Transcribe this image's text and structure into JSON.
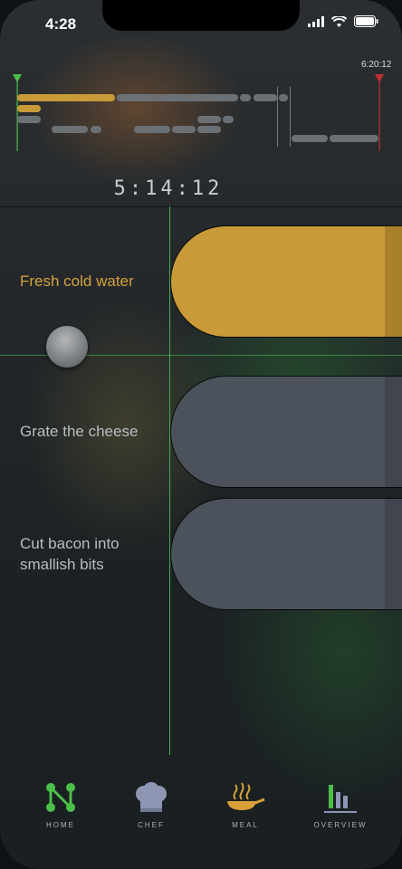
{
  "status": {
    "time": "4:28"
  },
  "timeline": {
    "end_time_label": "6:20:12"
  },
  "clock": "5:14:12",
  "tasks": [
    {
      "label": "Fresh cold water",
      "state": "active"
    },
    {
      "label": "Grate the cheese",
      "state": "pending"
    },
    {
      "label": "Cut bacon into smallish bits",
      "state": "pending"
    }
  ],
  "nav": [
    {
      "label": "HOME",
      "icon": "home-nodes-icon"
    },
    {
      "label": "CHEF",
      "icon": "chef-hat-icon"
    },
    {
      "label": "MEAL",
      "icon": "pan-icon"
    },
    {
      "label": "OVERVIEW",
      "icon": "bar-chart-icon"
    }
  ],
  "colors": {
    "accent_gold": "#c99a38",
    "pill_gray": "#4c525b",
    "guide_green": "#3fbf57",
    "end_marker_red": "#c0302c",
    "start_marker_green": "#4cbf4a"
  }
}
